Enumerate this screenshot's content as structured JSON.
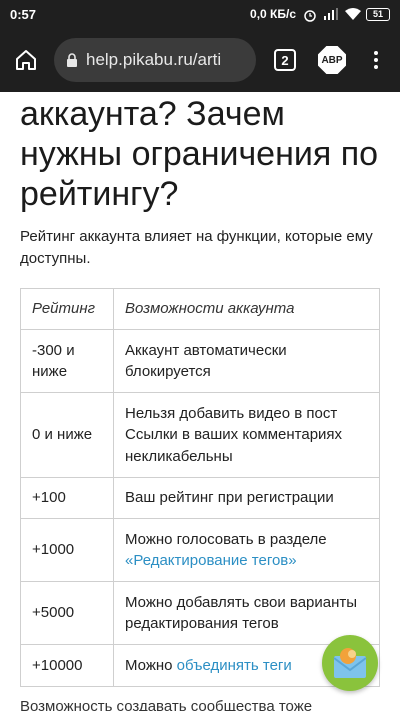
{
  "status_bar": {
    "time": "0:57",
    "network_speed": "0,0 КБ/с",
    "battery": "51"
  },
  "browser": {
    "url": "help.pikabu.ru/arti",
    "tab_count": "2",
    "abp_label": "ABP"
  },
  "article": {
    "heading": "аккаунта? Зачем нужны ограничения по рейтингу?",
    "intro": "Рейтинг аккаунта влияет на функции, которые ему доступны.",
    "table": {
      "headers": [
        "Рейтинг",
        "Возможности аккаунта"
      ],
      "rows": [
        {
          "rating": "-300 и ниже",
          "text": "Аккаунт автоматически блокируется"
        },
        {
          "rating": "0 и ниже",
          "text": "Нельзя добавить видео в пост Ссылки в ваших комментариях некликабельны"
        },
        {
          "rating": "+100",
          "text": "Ваш рейтинг при регистрации"
        },
        {
          "rating": "+1000",
          "text_prefix": "Можно голосовать в разделе",
          "link": "«Редактирование тегов»"
        },
        {
          "rating": "+5000",
          "text": "Можно добавлять свои варианты редактирования тегов"
        },
        {
          "rating": "+10000",
          "text_prefix": "Можно",
          "link": "объединять теги"
        }
      ]
    },
    "bottom_text": "Возможность создавать сообщества тоже"
  },
  "colors": {
    "toolbar_bg": "#1f1f1f",
    "link": "#2c8fc4",
    "fab_bg": "#8ac33c"
  }
}
